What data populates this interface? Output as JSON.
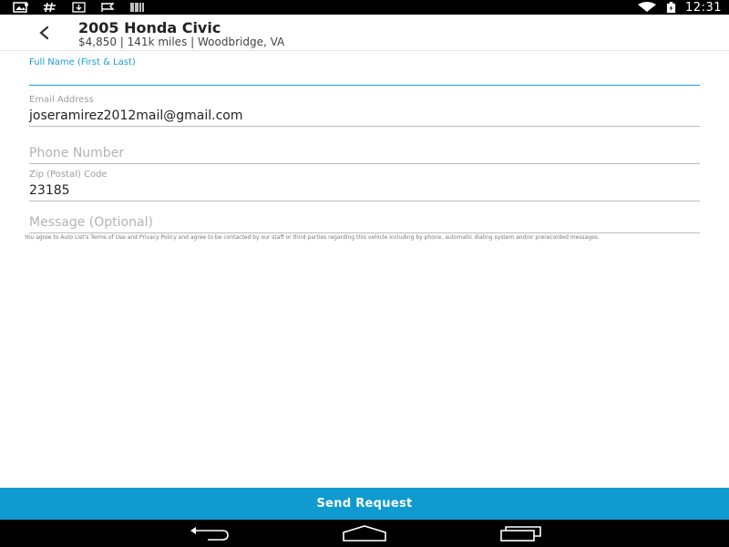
{
  "status_bar": {
    "time": "12:31",
    "icons": [
      "image-icon",
      "hash-icon",
      "download-icon",
      "flag-icon",
      "barcode-icon",
      "wifi-icon",
      "battery-charging-icon"
    ]
  },
  "header": {
    "back_icon": "chevron-left-icon",
    "title": "2005 Honda Civic",
    "subtitle": "$4,850 | 141k miles | Woodbridge, VA"
  },
  "form": {
    "full_name": {
      "label": "Full Name (First & Last)",
      "value": ""
    },
    "email": {
      "label": "Email Address",
      "value": "joseramirez2012mail@gmail.com"
    },
    "phone": {
      "placeholder": "Phone Number"
    },
    "zip": {
      "label": "Zip (Postal) Code",
      "value": "23185"
    },
    "message": {
      "placeholder": "Message (Optional)"
    },
    "disclaimer": "You agree to Auto List's Terms of Use and Privacy Policy and agree to be contacted by our staff or third parties regarding this vehicle including by phone, automatic dialing system and/or prerecorded messages."
  },
  "actions": {
    "send_label": "Send Request"
  },
  "colors": {
    "accent": "#1a9bd7",
    "button": "#0f9bd0",
    "status_bar": "#000000"
  },
  "nav_bar": {
    "icons": [
      "back-nav-icon",
      "home-nav-icon",
      "recents-nav-icon"
    ]
  }
}
